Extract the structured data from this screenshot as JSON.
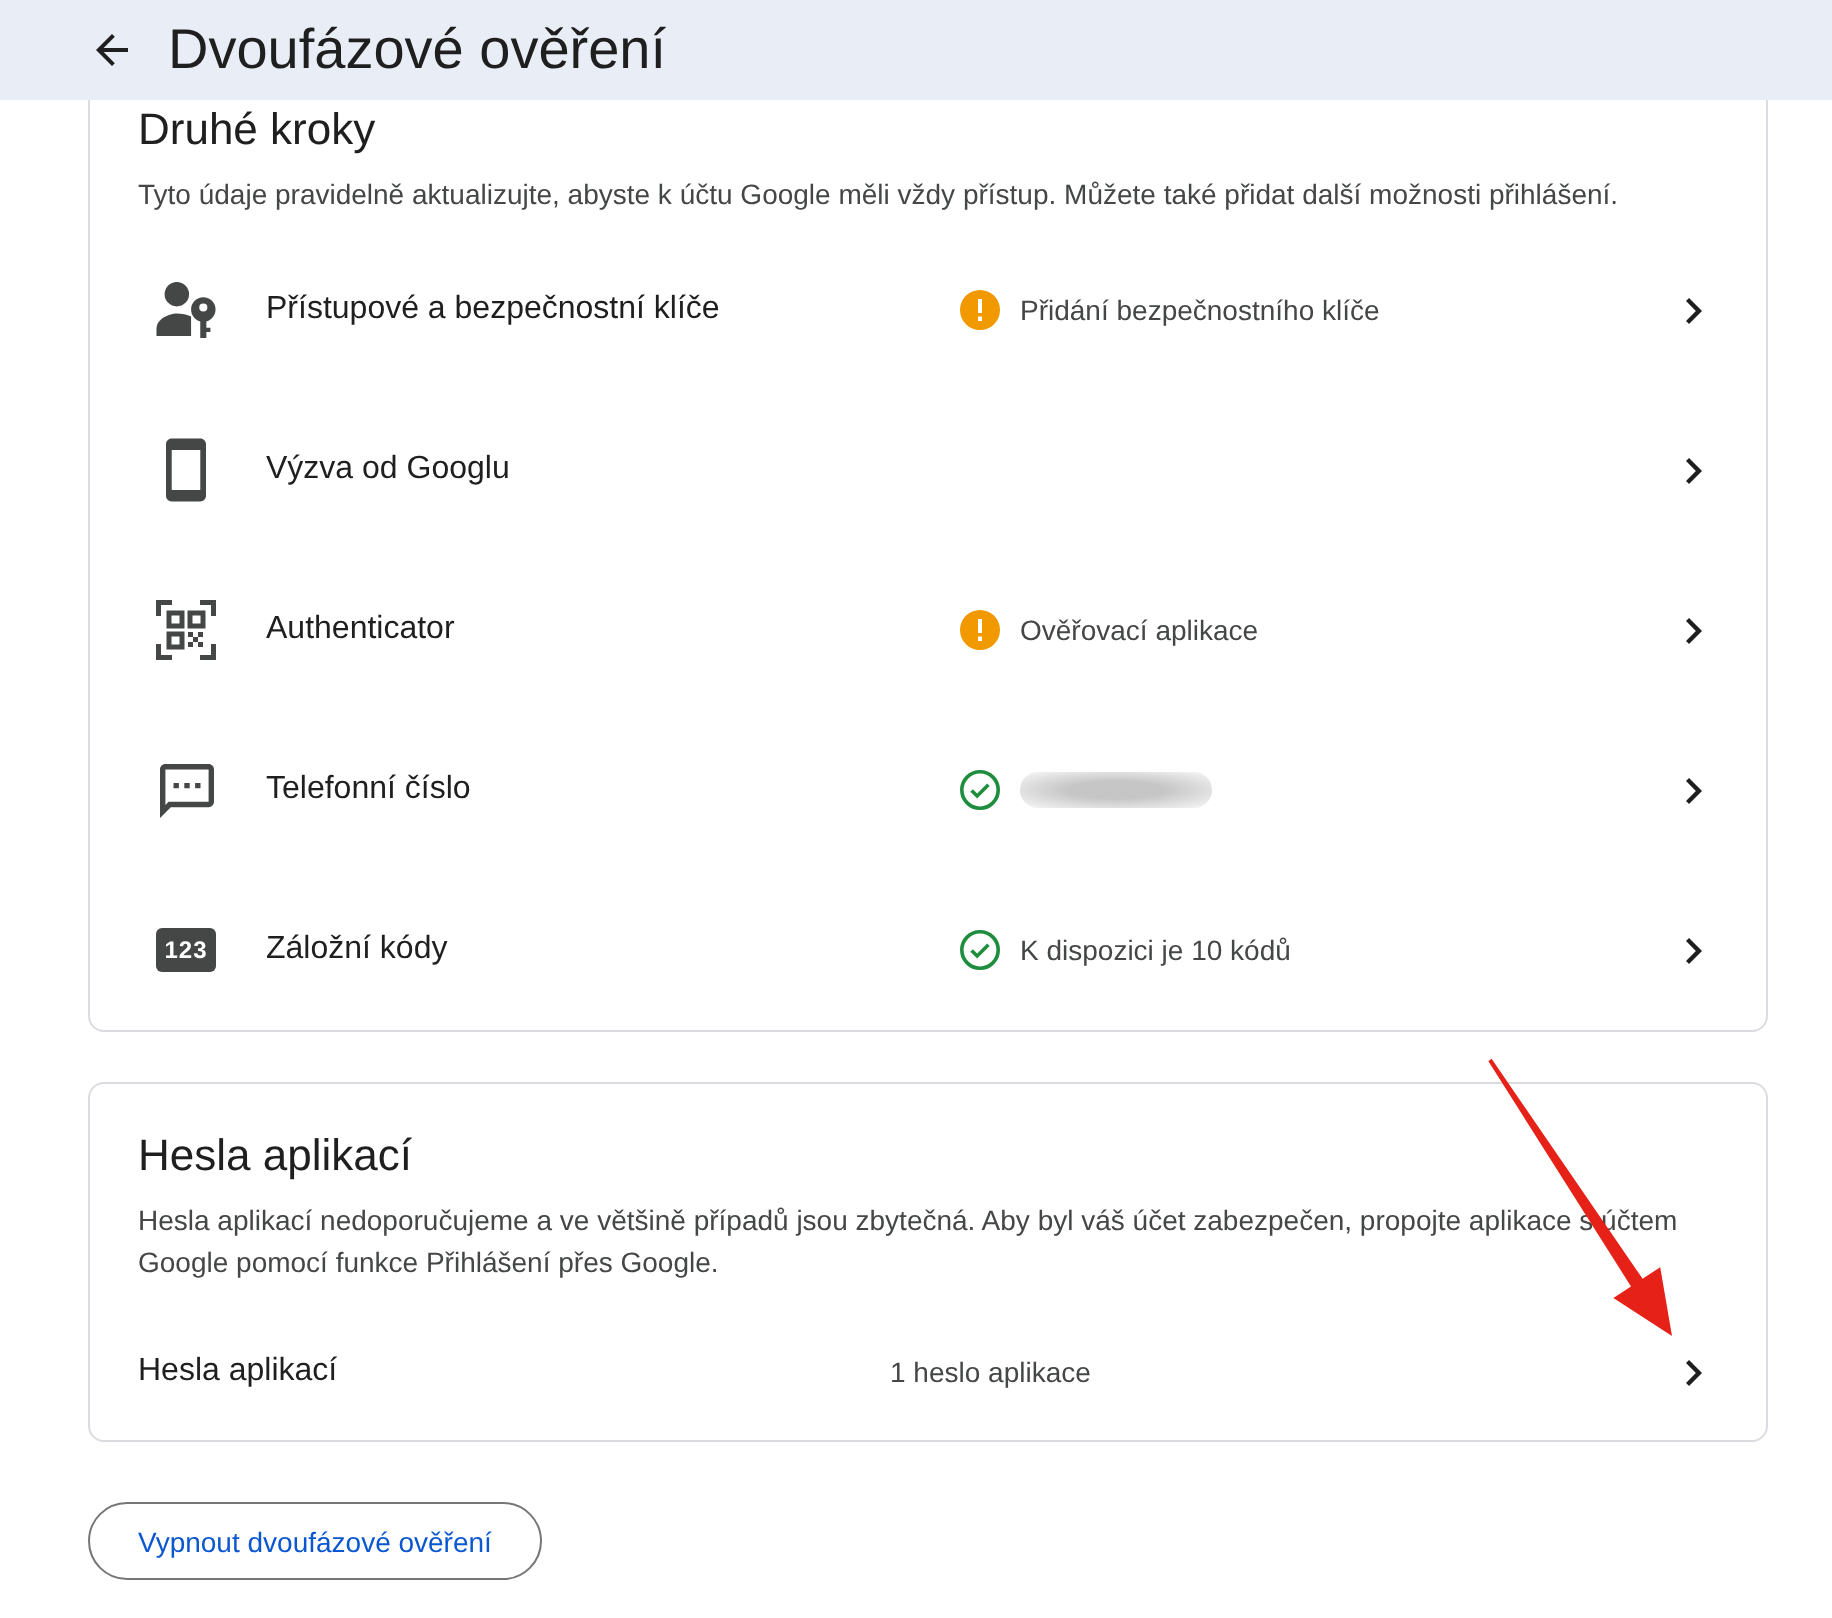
{
  "header": {
    "title": "Dvoufázové ověření"
  },
  "second_steps": {
    "title": "Druhé kroky",
    "description": "Tyto údaje pravidelně aktualizujte, abyste k účtu Google měli vždy přístup. Můžete také přidat další možnosti přihlášení.",
    "items": [
      {
        "label": "Přístupové a bezpečnostní klíče",
        "status": {
          "kind": "warning",
          "text": "Přidání bezpečnostního klíče"
        }
      },
      {
        "label": "Výzva od Googlu"
      },
      {
        "label": "Authenticator",
        "status": {
          "kind": "warning",
          "text": "Ověřovací aplikace"
        }
      },
      {
        "label": "Telefonní číslo",
        "status": {
          "kind": "ok",
          "redacted": true
        }
      },
      {
        "label": "Záložní kódy",
        "icon_text": "123",
        "status": {
          "kind": "ok",
          "text": "K dispozici je 10 kódů"
        }
      }
    ]
  },
  "app_passwords": {
    "title": "Hesla aplikací",
    "description": "Hesla aplikací nedoporučujeme a ve většině případů jsou zbytečná. Aby byl váš účet zabezpečen, propojte aplikace s účtem Google pomocí funkce Přihlášení přes Google.",
    "row": {
      "label": "Hesla aplikací",
      "value": "1 heslo aplikace"
    }
  },
  "turn_off_button": "Vypnout dvoufázové ověření",
  "annotations": [
    {
      "kind": "arrow"
    }
  ]
}
